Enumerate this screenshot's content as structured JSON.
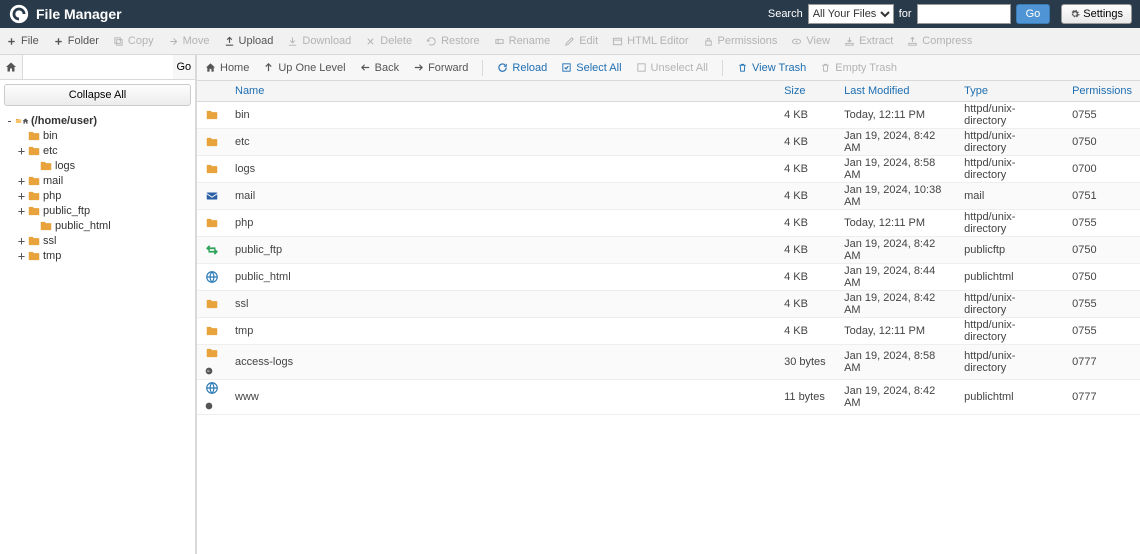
{
  "header": {
    "title": "File Manager",
    "search_label": "Search",
    "for_label": "for",
    "search_scope": "All Your Files",
    "go_label": "Go",
    "settings_label": "Settings"
  },
  "toolbar": [
    {
      "id": "file",
      "label": "File",
      "icon": "plus",
      "enabled": true
    },
    {
      "id": "folder",
      "label": "Folder",
      "icon": "plus",
      "enabled": true
    },
    {
      "id": "copy",
      "label": "Copy",
      "icon": "copy",
      "enabled": false
    },
    {
      "id": "move",
      "label": "Move",
      "icon": "move",
      "enabled": false
    },
    {
      "id": "upload",
      "label": "Upload",
      "icon": "upload",
      "enabled": true
    },
    {
      "id": "download",
      "label": "Download",
      "icon": "download",
      "enabled": false
    },
    {
      "id": "delete",
      "label": "Delete",
      "icon": "delete",
      "enabled": false
    },
    {
      "id": "restore",
      "label": "Restore",
      "icon": "restore",
      "enabled": false
    },
    {
      "id": "rename",
      "label": "Rename",
      "icon": "rename",
      "enabled": false
    },
    {
      "id": "edit",
      "label": "Edit",
      "icon": "edit",
      "enabled": false
    },
    {
      "id": "htmleditor",
      "label": "HTML Editor",
      "icon": "html",
      "enabled": false
    },
    {
      "id": "permissions",
      "label": "Permissions",
      "icon": "lock",
      "enabled": false
    },
    {
      "id": "view",
      "label": "View",
      "icon": "eye",
      "enabled": false
    },
    {
      "id": "extract",
      "label": "Extract",
      "icon": "extract",
      "enabled": false
    },
    {
      "id": "compress",
      "label": "Compress",
      "icon": "compress",
      "enabled": false
    }
  ],
  "sidebar": {
    "path": "",
    "go_label": "Go",
    "collapse_label": "Collapse All",
    "tree": [
      {
        "depth": 0,
        "toggle": "-",
        "icon": "folder-open-home",
        "label": "(/home/user)",
        "bold": true
      },
      {
        "depth": 1,
        "toggle": "",
        "icon": "folder",
        "label": "bin"
      },
      {
        "depth": 1,
        "toggle": "+",
        "icon": "folder",
        "label": "etc"
      },
      {
        "depth": 2,
        "toggle": "",
        "icon": "folder",
        "label": "logs"
      },
      {
        "depth": 1,
        "toggle": "+",
        "icon": "folder",
        "label": "mail"
      },
      {
        "depth": 1,
        "toggle": "+",
        "icon": "folder",
        "label": "php"
      },
      {
        "depth": 1,
        "toggle": "+",
        "icon": "folder",
        "label": "public_ftp"
      },
      {
        "depth": 2,
        "toggle": "",
        "icon": "folder",
        "label": "public_html"
      },
      {
        "depth": 1,
        "toggle": "+",
        "icon": "folder",
        "label": "ssl"
      },
      {
        "depth": 1,
        "toggle": "+",
        "icon": "folder",
        "label": "tmp"
      }
    ]
  },
  "navbar": [
    {
      "id": "home",
      "label": "Home",
      "icon": "home",
      "style": "normal"
    },
    {
      "id": "uponelevel",
      "label": "Up One Level",
      "icon": "up",
      "style": "normal"
    },
    {
      "id": "back",
      "label": "Back",
      "icon": "left",
      "style": "normal"
    },
    {
      "id": "forward",
      "label": "Forward",
      "icon": "right",
      "style": "normal"
    },
    {
      "id": "reload",
      "label": "Reload",
      "icon": "reload",
      "style": "blue"
    },
    {
      "id": "selectall",
      "label": "Select All",
      "icon": "check",
      "style": "blue"
    },
    {
      "id": "unselectall",
      "label": "Unselect All",
      "icon": "uncheck",
      "style": "disabled"
    },
    {
      "id": "viewtrash",
      "label": "View Trash",
      "icon": "trash",
      "style": "blue"
    },
    {
      "id": "emptytrash",
      "label": "Empty Trash",
      "icon": "trash",
      "style": "disabled"
    }
  ],
  "table": {
    "headers": {
      "name": "Name",
      "size": "Size",
      "modified": "Last Modified",
      "type": "Type",
      "permissions": "Permissions"
    },
    "rows": [
      {
        "icon": "folder",
        "name": "bin",
        "size": "4 KB",
        "modified": "Today, 12:11 PM",
        "type": "httpd/unix-directory",
        "permissions": "0755"
      },
      {
        "icon": "folder",
        "name": "etc",
        "size": "4 KB",
        "modified": "Jan 19, 2024, 8:42 AM",
        "type": "httpd/unix-directory",
        "permissions": "0750"
      },
      {
        "icon": "folder",
        "name": "logs",
        "size": "4 KB",
        "modified": "Jan 19, 2024, 8:58 AM",
        "type": "httpd/unix-directory",
        "permissions": "0700"
      },
      {
        "icon": "mail",
        "name": "mail",
        "size": "4 KB",
        "modified": "Jan 19, 2024, 10:38 AM",
        "type": "mail",
        "permissions": "0751"
      },
      {
        "icon": "folder",
        "name": "php",
        "size": "4 KB",
        "modified": "Today, 12:11 PM",
        "type": "httpd/unix-directory",
        "permissions": "0755"
      },
      {
        "icon": "ftp",
        "name": "public_ftp",
        "size": "4 KB",
        "modified": "Jan 19, 2024, 8:42 AM",
        "type": "publicftp",
        "permissions": "0750"
      },
      {
        "icon": "globe",
        "name": "public_html",
        "size": "4 KB",
        "modified": "Jan 19, 2024, 8:44 AM",
        "type": "publichtml",
        "permissions": "0750"
      },
      {
        "icon": "folder",
        "name": "ssl",
        "size": "4 KB",
        "modified": "Jan 19, 2024, 8:42 AM",
        "type": "httpd/unix-directory",
        "permissions": "0755"
      },
      {
        "icon": "folder",
        "name": "tmp",
        "size": "4 KB",
        "modified": "Today, 12:11 PM",
        "type": "httpd/unix-directory",
        "permissions": "0755"
      },
      {
        "icon": "folder-link",
        "name": "access-logs",
        "size": "30 bytes",
        "modified": "Jan 19, 2024, 8:58 AM",
        "type": "httpd/unix-directory",
        "permissions": "0777"
      },
      {
        "icon": "globe-link",
        "name": "www",
        "size": "11 bytes",
        "modified": "Jan 19, 2024, 8:42 AM",
        "type": "publichtml",
        "permissions": "0777"
      }
    ]
  }
}
